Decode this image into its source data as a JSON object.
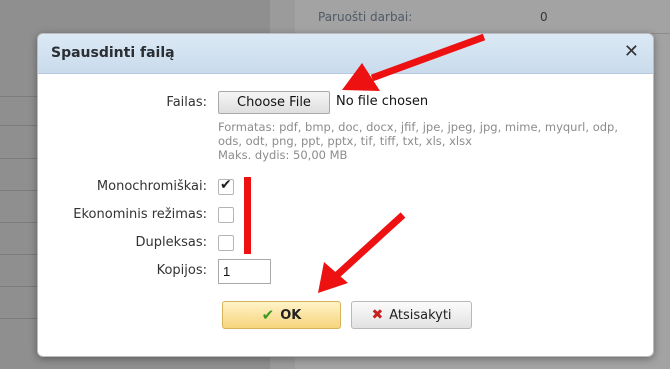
{
  "background": {
    "label": "Paruošti darbai:",
    "value": "0"
  },
  "dialog": {
    "title": "Spausdinti failą",
    "close_icon": "close-icon"
  },
  "form": {
    "file_label": "Failas:",
    "choose_file": "Choose File",
    "no_file": "No file chosen",
    "formats": "Formatas: pdf, bmp, doc, docx, jfif, jpe, jpeg, jpg, mime, myqurl, odp, ods, odt, png, ppt, pptx, tif, tiff, txt, xls, xlsx",
    "max_size": "Maks. dydis: 50,00 MB",
    "mono_label": "Monochromiškai:",
    "mono_checked": true,
    "eco_label": "Ekonominis režimas:",
    "eco_checked": false,
    "duplex_label": "Dupleksas:",
    "duplex_checked": false,
    "copies_label": "Kopijos:",
    "copies_value": "1"
  },
  "buttons": {
    "ok": "OK",
    "cancel": "Atsisakyti"
  },
  "colors": {
    "arrow": "#ee1111",
    "header": "#c9dbec",
    "ok_bg": "#f6d57d"
  }
}
